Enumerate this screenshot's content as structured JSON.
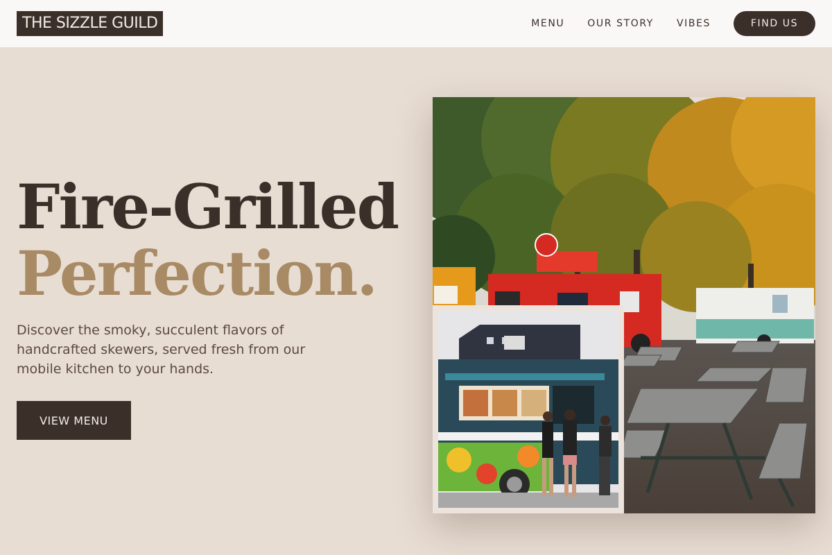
{
  "brand": {
    "logo_text": "THE SIZZLE GUILD"
  },
  "nav": {
    "links": [
      {
        "label": "MENU"
      },
      {
        "label": "OUR STORY"
      },
      {
        "label": "VIBES"
      }
    ],
    "cta_label": "FIND US"
  },
  "hero": {
    "title_line1": "Fire-Grilled",
    "title_line2": "Perfection.",
    "subtitle": "Discover the smoky, succulent flavors of handcrafted skewers, served fresh from our mobile kitchen to your hands.",
    "button_label": "VIEW MENU"
  },
  "images": {
    "main": "food-trucks-park-photo",
    "inset": "colorful-taco-truck-photo"
  },
  "colors": {
    "background": "#e8ddd2",
    "dark": "#3b2f2a",
    "accent": "#a88a65",
    "nav_bg": "#faf8f6"
  }
}
